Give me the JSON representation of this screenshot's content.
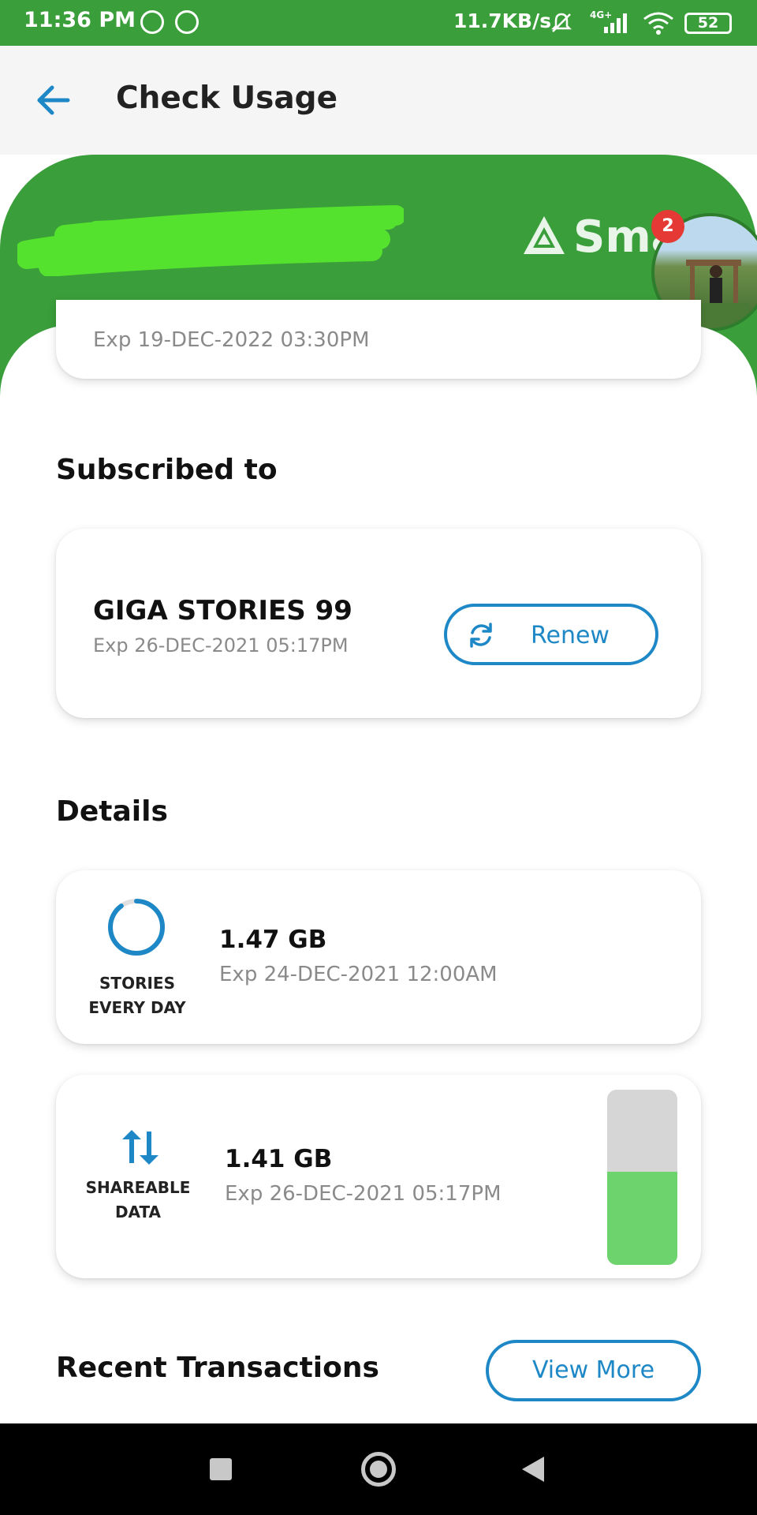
{
  "status_bar": {
    "time": "11:36 PM",
    "speed": "11.7KB/s",
    "network": "4G+",
    "battery": "52",
    "icons": [
      "messenger-icon",
      "messenger-icon",
      "mute-icon",
      "signal-icon",
      "wifi-icon",
      "battery-icon"
    ]
  },
  "app_bar": {
    "title": "Check Usage",
    "back_icon": "arrow-left-icon"
  },
  "header": {
    "brand_text": "Smart",
    "notification_count": "2",
    "colors": {
      "green": "#3a9e3a"
    }
  },
  "top_card": {
    "exp": "Exp 19-DEC-2022 03:30PM"
  },
  "subscribed": {
    "section_title": "Subscribed to",
    "name": "GIGA STORIES 99",
    "exp": "Exp 26-DEC-2021 05:17PM",
    "renew_label": "Renew"
  },
  "details": {
    "section_title": "Details",
    "items": [
      {
        "tag_line1": "STORIES",
        "tag_line2": "EVERY DAY",
        "amount": "1.47 GB",
        "exp": "Exp 24-DEC-2021 12:00AM",
        "ring_fraction": 0.9
      },
      {
        "tag_line1": "SHAREABLE",
        "tag_line2": "DATA",
        "amount": "1.41 GB",
        "exp": "Exp 26-DEC-2021 05:17PM",
        "remaining_fraction": 0.53
      }
    ]
  },
  "recent": {
    "section_title": "Recent Transactions",
    "view_more_label": "View More"
  },
  "colors": {
    "accent_blue": "#1e88c7",
    "bar_green": "#6dd36d",
    "bar_track": "#d6d6d6"
  }
}
